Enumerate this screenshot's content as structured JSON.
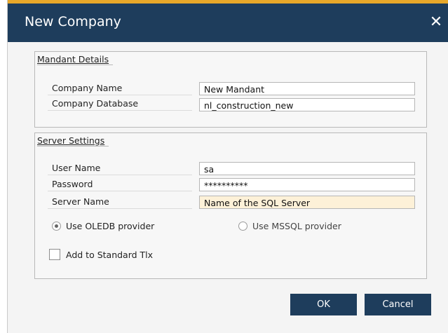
{
  "dialog": {
    "title": "New Company",
    "close_symbol": "✕"
  },
  "mandant": {
    "legend": "Mandant Details",
    "company_name_label": "Company Name",
    "company_name_value": "New Mandant",
    "company_db_label": "Company Database",
    "company_db_value": "nl_construction_new"
  },
  "server": {
    "legend": "Server Settings",
    "user_label": "User Name",
    "user_value": "sa",
    "password_label": "Password",
    "password_value": "**********",
    "server_label": "Server Name",
    "server_value": "Name of the SQL Server",
    "oledb_label": "Use OLEDB provider",
    "oledb_selected": true,
    "mssql_label": "Use MSSQL provider",
    "mssql_selected": false,
    "add_std_label": "Add to Standard Tlx",
    "add_std_checked": false
  },
  "buttons": {
    "ok": "OK",
    "cancel": "Cancel"
  },
  "colors": {
    "titlebar": "#1e3d5c",
    "accent": "#e8a82a",
    "server_name_field": "#fdf1d8"
  },
  "icons": {
    "close": "close-icon",
    "radio": "radio-icon",
    "checkbox": "checkbox-icon"
  }
}
